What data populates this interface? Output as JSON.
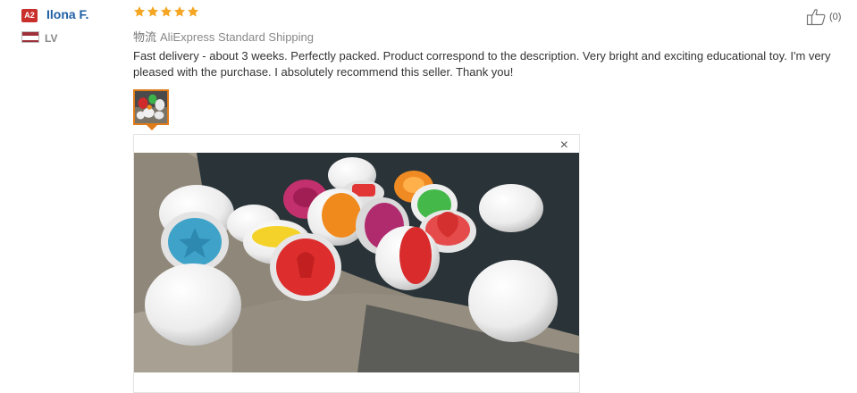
{
  "reviewer": {
    "level_badge": "A2",
    "name": "Ilona F.",
    "country_code": "LV",
    "flag_colors": [
      "#9e3039",
      "#ffffff",
      "#9e3039"
    ]
  },
  "rating": {
    "stars": 5,
    "max": 5,
    "star_color": "#f5a623"
  },
  "shipping": {
    "icon_text": "物流",
    "method": "AliExpress Standard Shipping"
  },
  "review": {
    "text": "Fast delivery - about 3 weeks. Perfectly packed. Product correspond to the description. Very bright and exciting educational toy. I'm very pleased with the purchase. I absolutely recommend this seller. Thank you!"
  },
  "helpful": {
    "count_label": "(0)",
    "icon": "thumbs-up-icon"
  },
  "photos": {
    "thumbnail_icon": "photo-thumbnail",
    "viewer_close": "×",
    "selected_index": 0,
    "count": 1
  }
}
